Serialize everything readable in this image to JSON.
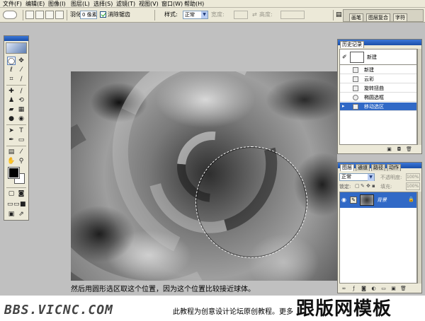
{
  "menu": [
    "文件(F)",
    "编辑(E)",
    "图像(I)",
    "图层(L)",
    "选择(S)",
    "滤镜(T)",
    "视图(V)",
    "窗口(W)",
    "帮助(H)"
  ],
  "options": {
    "feather_label": "羽化:",
    "feather_value": "0 像素",
    "antialias_label": "消除锯齿",
    "style_label": "样式:",
    "style_value": "正常",
    "width_label": "宽度:",
    "height_label": "高度:"
  },
  "panel_well": {
    "tabs": [
      "画笔",
      "图层复合",
      "字符"
    ]
  },
  "history": {
    "title": "历史记录",
    "snapshot_label": "新建",
    "items": [
      {
        "label": "新建",
        "selected": false
      },
      {
        "label": "云彩",
        "selected": false
      },
      {
        "label": "旋转扭曲",
        "selected": false
      },
      {
        "label": "椭圆选框",
        "selected": false
      },
      {
        "label": "移动选区",
        "selected": true
      }
    ]
  },
  "layers": {
    "tabs": [
      "图层",
      "通道",
      "路径",
      "动作"
    ],
    "blend_mode": "正常",
    "opacity_label": "不透明度:",
    "opacity_value": "100%",
    "lock_label": "锁定:",
    "fill_label": "填充:",
    "fill_value": "100%",
    "layer_name": "背景"
  },
  "caption": "然后用圆形选区取这个位置，因为这个位置比较接近球体。",
  "footer": {
    "site_url": "BBS.VICNC.COM",
    "note": "此教程为创意设计论坛原创教程。更多",
    "watermark": "跟版网模板"
  },
  "colors": {
    "foreground": "#000000",
    "background": "#ffffff",
    "selection_highlight": "#3169c6",
    "title_bar": "#1a4ea8"
  }
}
